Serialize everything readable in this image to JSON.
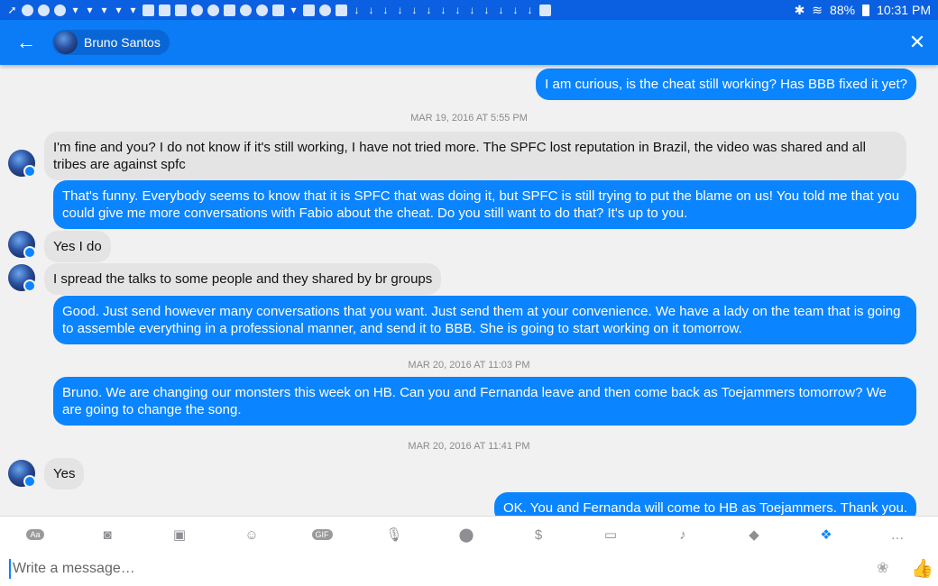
{
  "status_bar": {
    "battery": "88%",
    "time": "10:31 PM"
  },
  "header": {
    "contact_name": "Bruno Santos",
    "back_icon": "arrow-left-icon",
    "close_icon": "close-icon"
  },
  "colors": {
    "header": "#0b7cf5",
    "outgoing_bubble": "#0b84ff",
    "incoming_bubble": "#e4e4e4"
  },
  "messages": [
    {
      "type": "out",
      "text": "I am curious, is the cheat still working? Has BBB fixed it yet?"
    },
    {
      "type": "timestamp",
      "text": "MAR 19, 2016 AT 5:55 PM"
    },
    {
      "type": "in",
      "text": "I'm fine and you? I do not know if it's still working, I have not tried more. The SPFC lost reputation in Brazil, the video was shared and all tribes are against spfc"
    },
    {
      "type": "out",
      "text": "That's funny. Everybody seems to know that it is SPFC that was doing it, but SPFC is still trying to put the blame on us! You told me that you could give me more conversations with Fabio about the cheat. Do you still want to do that? It's up to you."
    },
    {
      "type": "in",
      "text": "Yes I do"
    },
    {
      "type": "in",
      "text": "I spread the talks to some people and they shared by br groups"
    },
    {
      "type": "out",
      "text": "Good. Just send however many conversations that you want. Just send them at your convenience. We have a lady on the team that is going to assemble everything in a professional manner, and send it to BBB. She is going to start working on it tomorrow."
    },
    {
      "type": "timestamp",
      "text": "MAR 20, 2016 AT 11:03 PM"
    },
    {
      "type": "out",
      "text": "Bruno. We are changing our monsters this week on HB. Can you and Fernanda leave and then come back as Toejammers tomorrow? We are going to change the song."
    },
    {
      "type": "timestamp",
      "text": "MAR 20, 2016 AT 11:41 PM"
    },
    {
      "type": "in",
      "text": "Yes"
    },
    {
      "type": "out",
      "text": "OK. You and Fernanda will come to HB as Toejammers. Thank you."
    }
  ],
  "toolbar": {
    "text_badge": "Aa",
    "gif_badge": "GIF",
    "tools": [
      "text-format-icon",
      "camera-icon",
      "gallery-icon",
      "emoji-icon",
      "gif-icon",
      "microphone-icon",
      "location-icon",
      "payment-icon",
      "car-icon",
      "bell-icon",
      "game-controller-icon",
      "dropbox-icon",
      "more-icon"
    ]
  },
  "composer": {
    "placeholder": "Write a message…"
  }
}
